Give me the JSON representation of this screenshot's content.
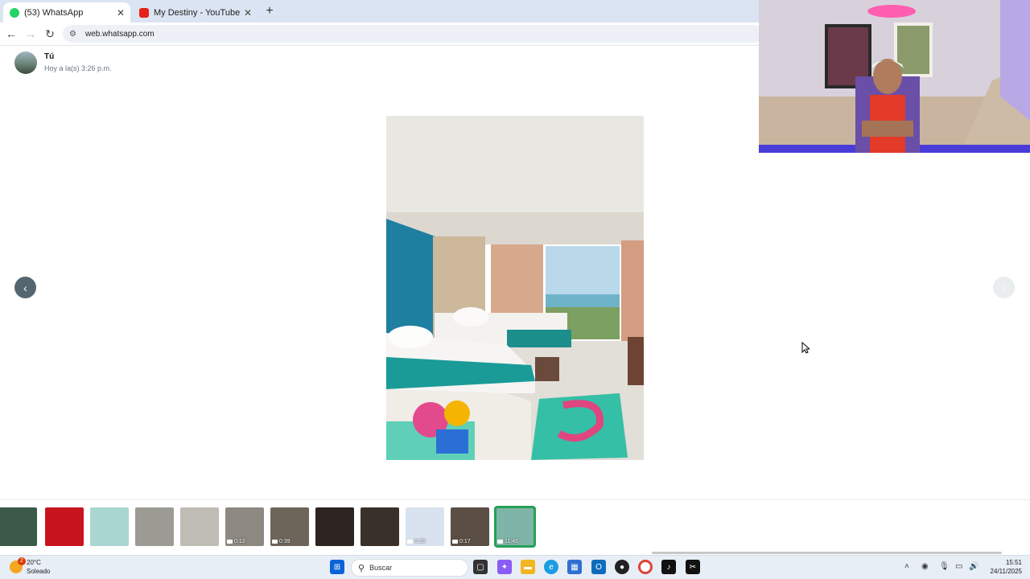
{
  "browser": {
    "tabs": [
      {
        "title": "(53) WhatsApp",
        "badge": "53",
        "active": true
      },
      {
        "title": "My Destiny - YouTube",
        "active": false
      }
    ],
    "url": "web.whatsapp.com"
  },
  "viewer": {
    "sender": "Tú",
    "timestamp": "Hoy a la(s) 3:26 p.m."
  },
  "thumbnails": [
    {
      "duration": ""
    },
    {
      "duration": ""
    },
    {
      "duration": ""
    },
    {
      "duration": ""
    },
    {
      "duration": ""
    },
    {
      "duration": "0:12"
    },
    {
      "duration": "0:39"
    },
    {
      "duration": ""
    },
    {
      "duration": ""
    },
    {
      "duration": "0:20"
    },
    {
      "duration": "0:17"
    },
    {
      "duration": "11:46",
      "selected": true
    }
  ],
  "taskbar": {
    "temperature": "20°C",
    "condition": "Soleado",
    "weather_badge": "2",
    "search_placeholder": "Buscar",
    "time": "15:51",
    "date": "24/11/2025"
  },
  "colors": {
    "accent_green": "#25a056",
    "nav_prev": "#54656f",
    "tabbar": "#dbe4f2"
  }
}
